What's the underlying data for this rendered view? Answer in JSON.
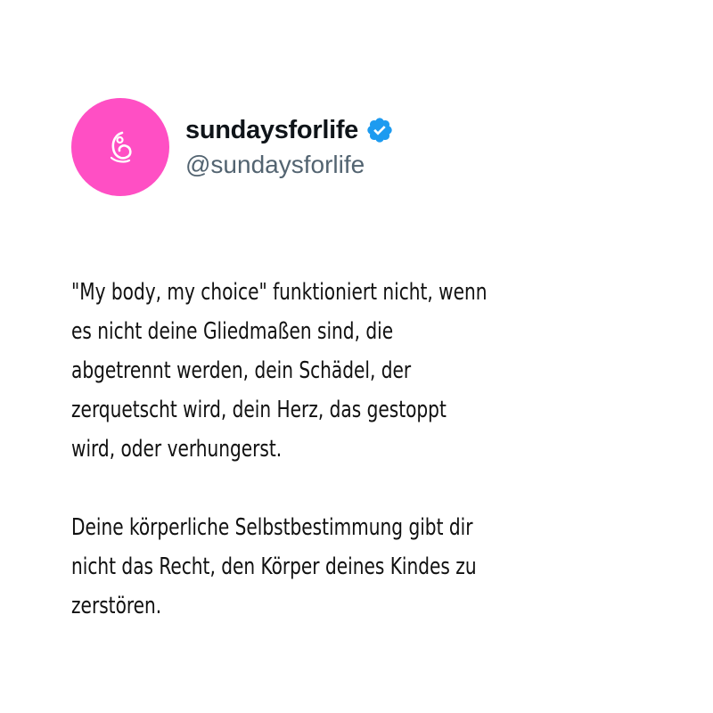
{
  "profile": {
    "display_name": "sundaysforlife",
    "handle": "@sundaysforlife",
    "verified": true,
    "avatar_color": "#ff4fc4",
    "verified_color": "#1d9bf0",
    "avatar_icon": "fetus-icon"
  },
  "post": {
    "paragraph1": [
      "\"My body, my choice\" funktioniert nicht, wenn",
      "es nicht deine Gliedmaßen sind, die",
      "abgetrennt werden, dein Schädel, der",
      "zerquetscht wird, dein Herz, das gestoppt",
      "wird, oder verhungerst."
    ],
    "paragraph2": [
      "Deine körperliche Selbstbestimmung gibt dir",
      "nicht das Recht, den Körper deines Kindes zu",
      "zerstören."
    ]
  }
}
